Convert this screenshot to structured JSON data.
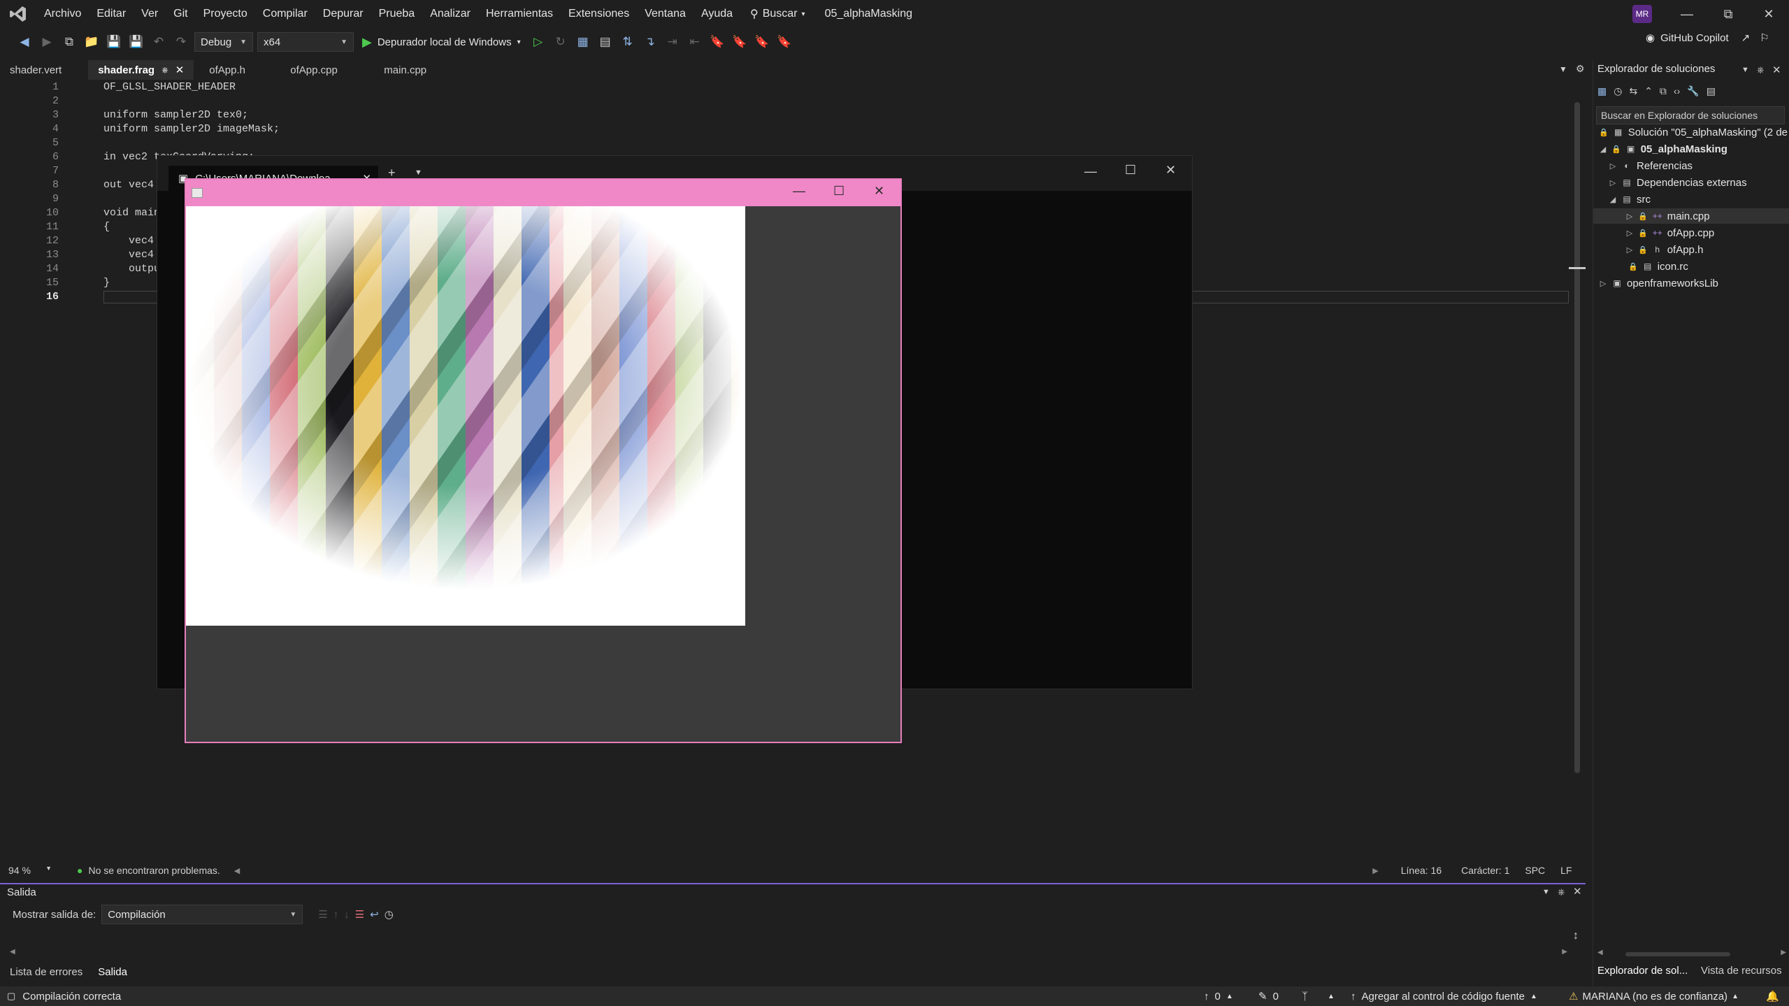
{
  "menubar": {
    "items": [
      "Archivo",
      "Editar",
      "Ver",
      "Git",
      "Proyecto",
      "Compilar",
      "Depurar",
      "Prueba",
      "Analizar",
      "Herramientas",
      "Extensiones",
      "Ventana",
      "Ayuda"
    ],
    "search_label": "Buscar",
    "solution_name": "05_alphaMasking",
    "avatar": "MR"
  },
  "toolbar": {
    "config": "Debug",
    "platform": "x64",
    "run_label": "Depurador local de Windows",
    "copilot_label": "GitHub Copilot"
  },
  "tabs": [
    {
      "label": "shader.vert"
    },
    {
      "label": "shader.frag",
      "active": true
    },
    {
      "label": "ofApp.h"
    },
    {
      "label": "ofApp.cpp"
    },
    {
      "label": "main.cpp"
    }
  ],
  "editor": {
    "line_numbers": [
      "1",
      "2",
      "3",
      "4",
      "5",
      "6",
      "7",
      "8",
      "9",
      "10",
      "11",
      "12",
      "13",
      "14",
      "15",
      "16"
    ],
    "lines": [
      "OF_GLSL_SHADER_HEADER",
      "",
      "uniform sampler2D tex0;",
      "uniform sampler2D imageMask;",
      "",
      "in vec2 texCoordVarying;",
      "",
      "out vec4",
      "",
      "void main",
      "{",
      "    vec4",
      "    vec4",
      "    outpu",
      "}",
      ""
    ],
    "current_line": "16"
  },
  "editor_status": {
    "zoom": "94 %",
    "issues": "No se encontraron problemas.",
    "line": "Línea: 16",
    "char": "Carácter: 1",
    "spc": "SPC",
    "eol": "LF"
  },
  "output": {
    "title": "Salida",
    "show_label": "Mostrar salida de:",
    "source": "Compilación"
  },
  "bottom_tabs": [
    "Lista de errores",
    "Salida"
  ],
  "statusbar": {
    "message": "Compilación correcta",
    "errors": "0",
    "edits": "0",
    "source_control": "Agregar al control de código fuente",
    "user": "MARIANA (no es de confianza)"
  },
  "solution_explorer": {
    "title": "Explorador de soluciones",
    "search_placeholder": "Buscar en Explorador de soluciones",
    "solution": "Solución \"05_alphaMasking\" (2 de",
    "project": "05_alphaMasking",
    "references": "Referencias",
    "external_deps": "Dependencias externas",
    "src": "src",
    "files": [
      "main.cpp",
      "ofApp.cpp",
      "ofApp.h"
    ],
    "icon_rc": "icon.rc",
    "lib": "openframeworksLib",
    "bottom_tab_1": "Explorador de sol...",
    "bottom_tab_2": "Vista de recursos"
  },
  "console": {
    "tab_title": "C:\\Users\\MARIANA\\Downloa"
  },
  "colors": {
    "accent_purple": "#7b61d8",
    "of_titlebar": "#f088c8",
    "run_green": "#4ec94e"
  }
}
